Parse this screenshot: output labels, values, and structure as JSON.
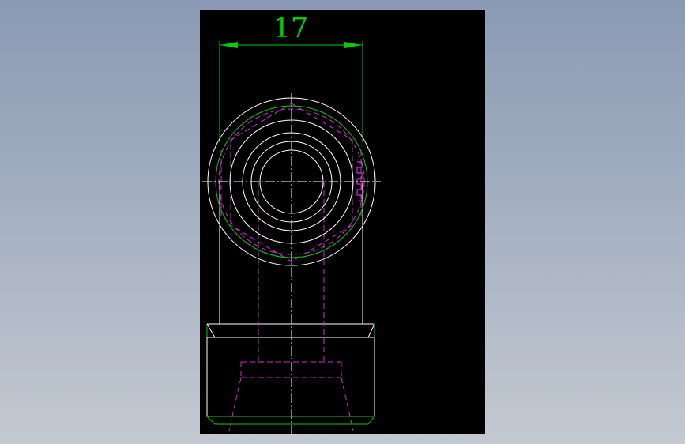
{
  "drawing": {
    "dimension_value": "17",
    "colors": {
      "background": "#000000",
      "object_line": "#ffffff",
      "green_line": "#00cc00",
      "hidden_line": "#cc33cc",
      "center_line": "#ffffff"
    }
  }
}
